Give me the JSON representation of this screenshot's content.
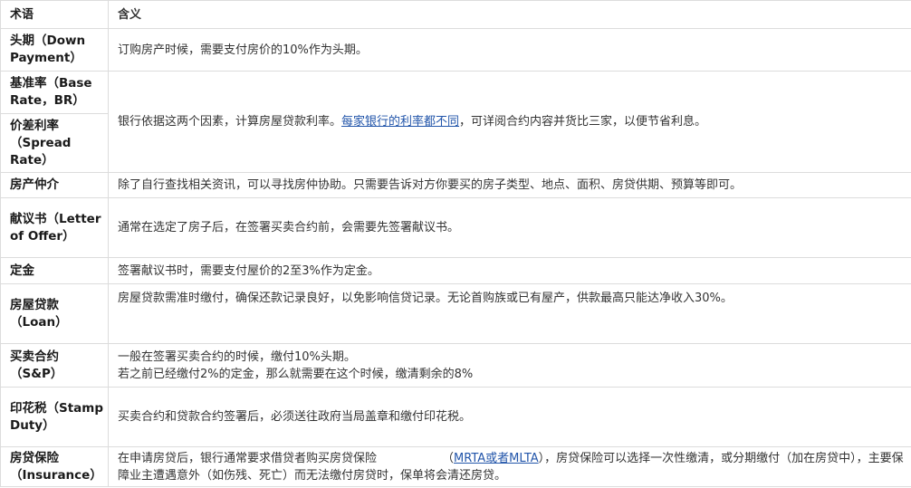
{
  "header": {
    "term": "术语",
    "meaning": "含义"
  },
  "rows": [
    {
      "term": "头期（Down Payment）",
      "def": "订购房产时候，需要支付房价的10%作为头期。"
    },
    {
      "term_a": "基准率（Base Rate，BR）",
      "term_b": "价差利率（Spread Rate）",
      "def_prefix": "银行依据这两个因素，计算房屋贷款利率。",
      "def_link": "每家银行的利率都不同",
      "def_suffix": "，可详阅合约内容并货比三家，以便节省利息。"
    },
    {
      "term": "房产仲介",
      "def": "除了自行查找相关资讯，可以寻找房仲协助。只需要告诉对方你要买的房子类型、地点、面积、房贷供期、预算等即可。"
    },
    {
      "term": "献议书（Letter of Offer）",
      "def": "通常在选定了房子后，在签署买卖合约前，会需要先签署献议书。"
    },
    {
      "term": "定金",
      "def": "签署献议书时，需要支付屋价的2至3%作为定金。"
    },
    {
      "term": "房屋贷款（Loan）",
      "def": "房屋贷款需准时缴付，确保还款记录良好，以免影响信贷记录。无论首购族或已有屋产，供款最高只能达净收入30%。"
    },
    {
      "term": "买卖合约（S&P）",
      "def_line1": "一般在签署买卖合约的时候，缴付10%头期。",
      "def_line2": "若之前已经缴付2%的定金，那么就需要在这个时候，缴清剩余的8%"
    },
    {
      "term": "印花税（Stamp Duty）",
      "def": "买卖合约和贷款合约签署后，必须送往政府当局盖章和缴付印花税。"
    },
    {
      "term": "房贷保险（Insurance）",
      "def_prefix": "在申请房贷后，银行通常要求借贷者购买房贷保险",
      "def_link": "MRTA或者MLTA",
      "def_suffix": "），房贷保险可以选择一次性缴清，或分期缴付（加在房贷中），主要保障业主遭遇意外（如伤残、死亡）而无法缴付房贷时，保单将会清还房贷。",
      "def_paren": "（"
    }
  ]
}
